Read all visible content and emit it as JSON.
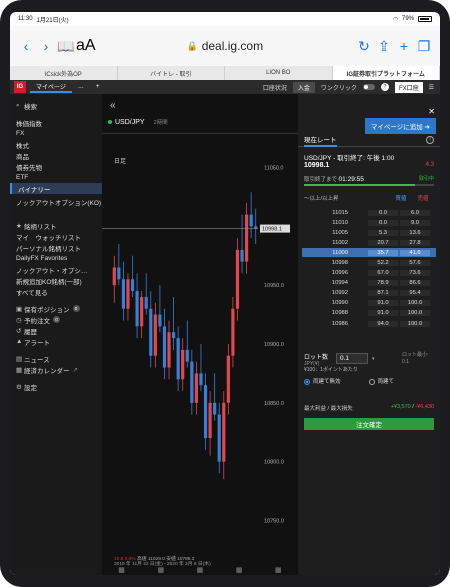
{
  "status": {
    "time": "11:30",
    "date": "1月21日(火)",
    "battery": "79%"
  },
  "browser": {
    "aa": "aA",
    "url": "deal.ig.com"
  },
  "tabs": [
    "ICsick外為OP",
    "バイトレ - 取引",
    "LION BO",
    "IG証券取引プラットフォーム"
  ],
  "topbar": {
    "logo": "IG",
    "mypage": "マイページ",
    "more": "…",
    "add": "+",
    "account_status": "口座状況",
    "deposit": "入金",
    "oneclick": "ワンクリック",
    "account": "FX口座"
  },
  "sidebar": {
    "search": "検索",
    "markets": [
      "株価指数",
      "FX",
      "株式",
      "商品",
      "債券先物",
      "ETF",
      "バイナリー",
      "ノックアウトオプション(KO)"
    ],
    "lists_header": "銘柄リスト",
    "lists": [
      "マイ　ウォッチリスト",
      "パーソナル銘柄リスト",
      "DailyFX Favorites",
      "ノックアウト・オプシ…",
      "新規追加KO銘柄(一部)",
      "すべて見る"
    ],
    "positions": "保有ポジション",
    "positions_count": "0",
    "orders": "予約注文",
    "orders_count": "0",
    "history": "履歴",
    "alerts": "アラート",
    "news": "ニュース",
    "calendar": "経済カレンダー",
    "settings": "設定"
  },
  "chart": {
    "pair": "USD/JPY",
    "interval": "2時間",
    "timeframe": "日足",
    "info_line1_chg": "10.8  0.0%",
    "info_line1_rest": "高値 11029.0  安値 10785.2",
    "info_line2": "2019 年 11月 22 日(金) - 2020 年 2月 6 日(木)",
    "current_label": "10998.1"
  },
  "chart_data": {
    "type": "candlestick",
    "yticks": [
      11050,
      11000,
      10950,
      10900,
      10850,
      10800,
      10750
    ],
    "ylim": [
      10730,
      11070
    ],
    "current": 10998.1,
    "candles": [
      [
        10950,
        10975,
        10935,
        10965
      ],
      [
        10965,
        10985,
        10950,
        10955
      ],
      [
        10955,
        10970,
        10920,
        10930
      ],
      [
        10930,
        10960,
        10920,
        10955
      ],
      [
        10955,
        10975,
        10940,
        10945
      ],
      [
        10945,
        10960,
        10905,
        10915
      ],
      [
        10915,
        10945,
        10905,
        10940
      ],
      [
        10940,
        10960,
        10925,
        10930
      ],
      [
        10930,
        10945,
        10880,
        10890
      ],
      [
        10890,
        10935,
        10880,
        10925
      ],
      [
        10925,
        10950,
        10910,
        10915
      ],
      [
        10915,
        10930,
        10870,
        10880
      ],
      [
        10880,
        10920,
        10870,
        10910
      ],
      [
        10910,
        10940,
        10895,
        10905
      ],
      [
        10905,
        10915,
        10860,
        10870
      ],
      [
        10870,
        10905,
        10860,
        10895
      ],
      [
        10895,
        10920,
        10880,
        10885
      ],
      [
        10885,
        10895,
        10840,
        10850
      ],
      [
        10850,
        10885,
        10840,
        10875
      ],
      [
        10875,
        10900,
        10860,
        10865
      ],
      [
        10865,
        10875,
        10810,
        10820
      ],
      [
        10820,
        10860,
        10805,
        10850
      ],
      [
        10850,
        10875,
        10835,
        10840
      ],
      [
        10840,
        10850,
        10790,
        10800
      ],
      [
        10800,
        10860,
        10785,
        10850
      ],
      [
        10850,
        10900,
        10840,
        10890
      ],
      [
        10890,
        10940,
        10880,
        10930
      ],
      [
        10930,
        10990,
        10920,
        10980
      ],
      [
        10980,
        11010,
        10960,
        10970
      ],
      [
        10970,
        11020,
        10960,
        11010
      ],
      [
        11010,
        11029,
        10990,
        11000
      ],
      [
        11000,
        11015,
        10985,
        10998
      ]
    ]
  },
  "ticket": {
    "mypage_add": "マイページに追加",
    "tab": "現在レート",
    "market": "USD/JPY - 取引終了: 午後 1:00",
    "price": "10998.1",
    "change": "4.3",
    "expiry_label": "取引終了まで",
    "expiry_time": "01:29:55",
    "expiry_right": "取引中",
    "progress": 0.85,
    "col_label": "〜以上/以上昇",
    "col_buy": "買値",
    "col_sell": "売値",
    "ladder": [
      {
        "strike": "11015",
        "buy": "0.0",
        "sell": "6.0"
      },
      {
        "strike": "11010",
        "buy": "0.0",
        "sell": "9.0"
      },
      {
        "strike": "11005",
        "buy": "5.3",
        "sell": "13.6"
      },
      {
        "strike": "11002",
        "buy": "20.7",
        "sell": "27.8"
      },
      {
        "strike": "11000",
        "buy": "35.7",
        "sell": "41.6"
      },
      {
        "strike": "10998",
        "buy": "52.2",
        "sell": "57.6"
      },
      {
        "strike": "10996",
        "buy": "67.0",
        "sell": "73.6"
      },
      {
        "strike": "10994",
        "buy": "78.9",
        "sell": "86.6"
      },
      {
        "strike": "10992",
        "buy": "87.1",
        "sell": "95.4"
      },
      {
        "strike": "10990",
        "buy": "91.0",
        "sell": "100.0"
      },
      {
        "strike": "10988",
        "buy": "91.0",
        "sell": "100.0"
      },
      {
        "strike": "10986",
        "buy": "94.0",
        "sell": "100.0"
      }
    ],
    "lots_label": "ロット数",
    "lots_sub": "JPY(¥)",
    "lots_value": "0.1",
    "min_lot": "ロット最小: 0.1",
    "per_point": "¥100：1ポイントあたり",
    "radio_both": "両建て無効",
    "radio_hedge": "両建て",
    "profit_label": "最大利益 / 最大損失",
    "profit_value": "+¥3,570",
    "loss_value": "-¥6,430",
    "confirm": "注文確定"
  }
}
